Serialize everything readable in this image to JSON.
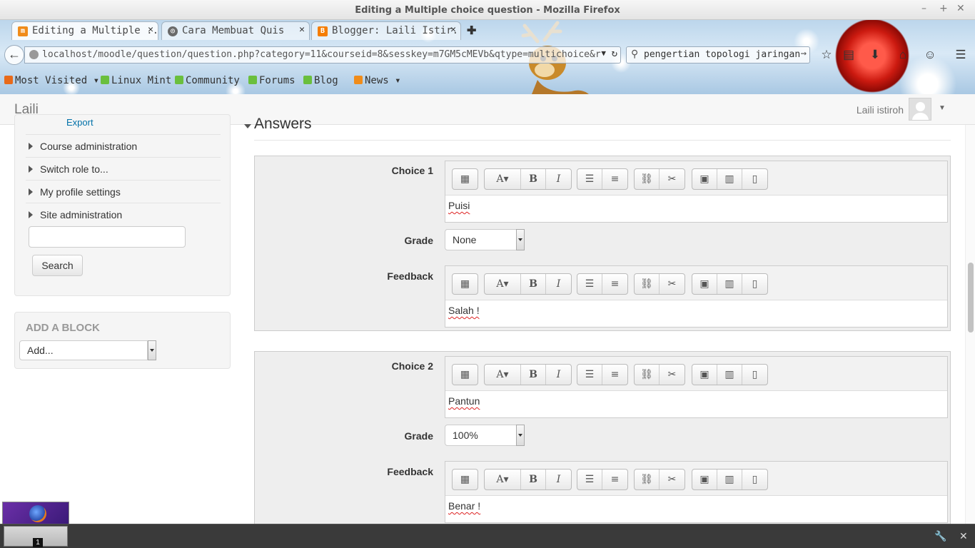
{
  "window": {
    "title": "Editing a Multiple choice question - Mozilla Firefox"
  },
  "tabs": [
    {
      "label": "Editing a Multiple ...",
      "icon": "moodle-icon",
      "active": true
    },
    {
      "label": "Cara Membuat Quis",
      "icon": "mint-icon",
      "active": false
    },
    {
      "label": "Blogger: Laili Istir...",
      "icon": "blogger-icon",
      "active": false
    }
  ],
  "nav": {
    "url": "localhost/moodle/question/question.php?category=11&courseid=8&sesskey=m7GM5cMEVb&qtype=multichoice&r",
    "search": "pengertian topologi jaringan"
  },
  "bookmarks": [
    "Most Visited",
    "Linux Mint",
    "Community",
    "Forums",
    "Blog",
    "News"
  ],
  "moodle": {
    "brand": "Laili",
    "user": "Laili istiroh"
  },
  "admin": {
    "cut_link": "Export",
    "items": [
      "Course administration",
      "Switch role to...",
      "My profile settings",
      "Site administration"
    ],
    "search_button": "Search"
  },
  "add_block": {
    "title": "ADD A BLOCK",
    "select": "Add..."
  },
  "answers": {
    "heading": "Answers",
    "choices": [
      {
        "label": "Choice 1",
        "text": "Puisi",
        "grade_label": "Grade",
        "grade": "None",
        "feedback_label": "Feedback",
        "feedback": "Salah !"
      },
      {
        "label": "Choice 2",
        "text": "Pantun",
        "grade_label": "Grade",
        "grade": "100%",
        "feedback_label": "Feedback",
        "feedback": "Benar !"
      }
    ]
  },
  "taskbar": {
    "workspace_number": "1"
  }
}
